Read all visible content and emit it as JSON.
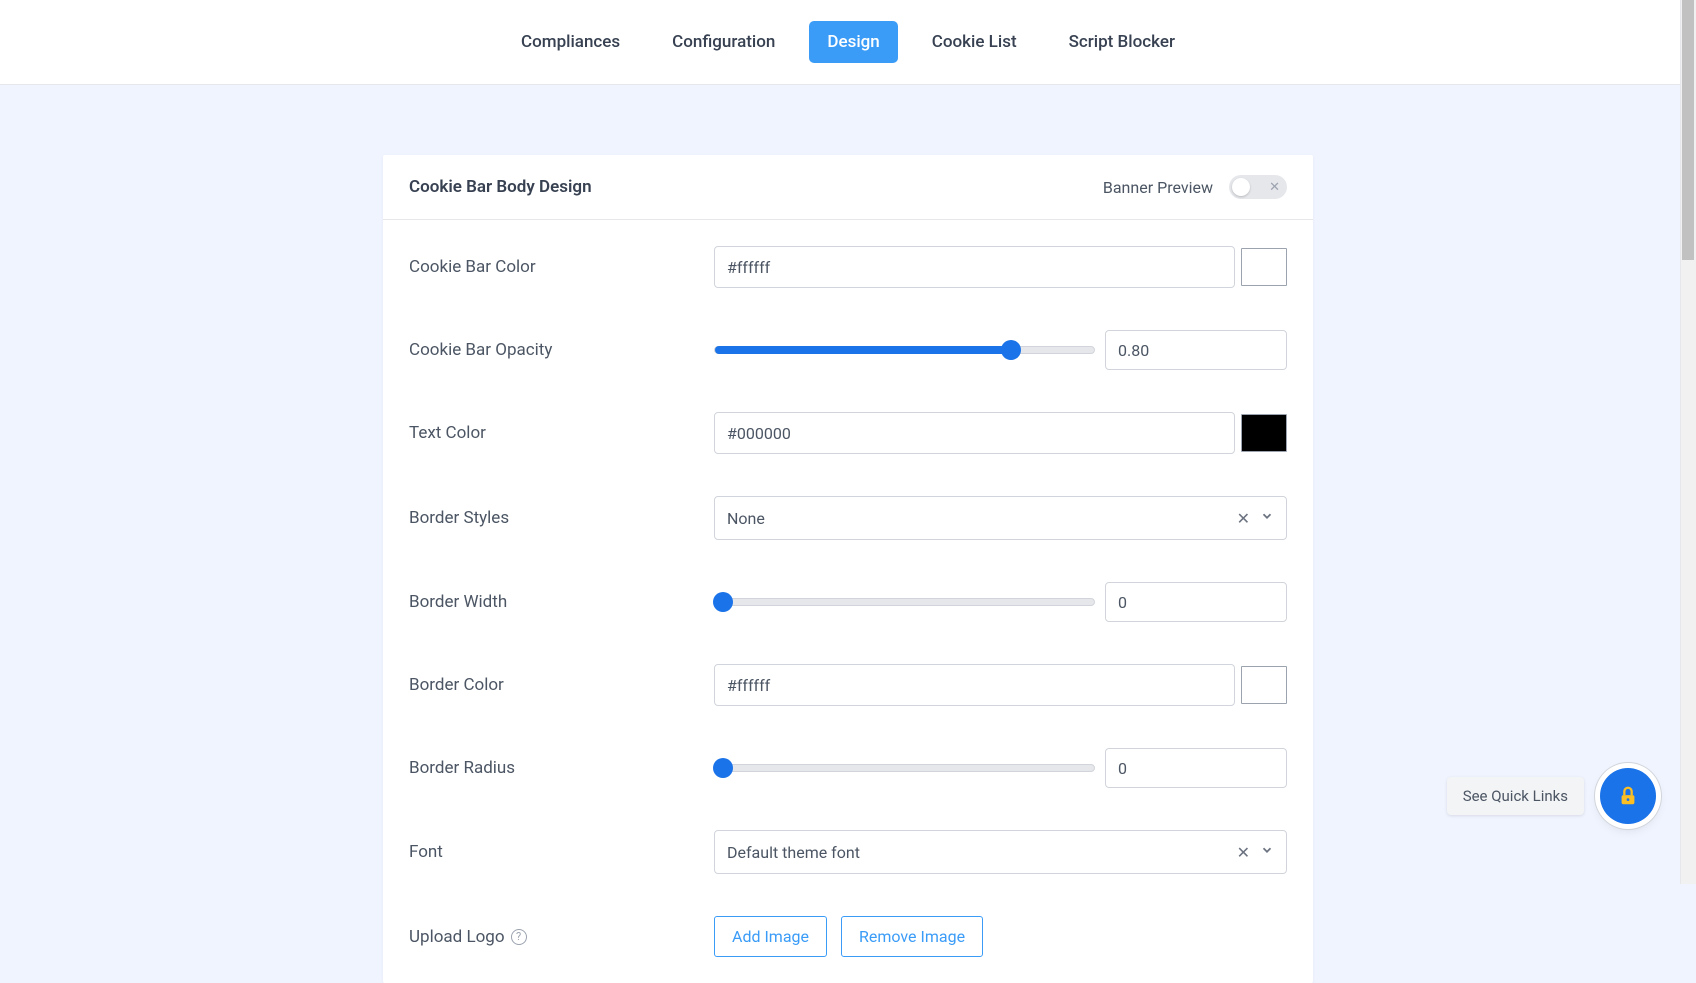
{
  "nav": {
    "tabs": [
      {
        "label": "Compliances",
        "active": false
      },
      {
        "label": "Configuration",
        "active": false
      },
      {
        "label": "Design",
        "active": true
      },
      {
        "label": "Cookie List",
        "active": false
      },
      {
        "label": "Script Blocker",
        "active": false
      }
    ]
  },
  "card": {
    "title": "Cookie Bar Body Design",
    "preview_label": "Banner Preview",
    "preview_enabled": false
  },
  "fields": {
    "cookie_bar_color": {
      "label": "Cookie Bar Color",
      "value": "#ffffff",
      "swatch": "#ffffff"
    },
    "cookie_bar_opacity": {
      "label": "Cookie Bar Opacity",
      "value": "0.80",
      "percent": 78
    },
    "text_color": {
      "label": "Text Color",
      "value": "#000000",
      "swatch": "#000000"
    },
    "border_styles": {
      "label": "Border Styles",
      "value": "None"
    },
    "border_width": {
      "label": "Border Width",
      "value": "0",
      "percent": 0
    },
    "border_color": {
      "label": "Border Color",
      "value": "#ffffff",
      "swatch": "#ffffff"
    },
    "border_radius": {
      "label": "Border Radius",
      "value": "0",
      "percent": 0
    },
    "font": {
      "label": "Font",
      "value": "Default theme font"
    },
    "upload_logo": {
      "label": "Upload Logo",
      "add_button": "Add Image",
      "remove_button": "Remove Image"
    }
  },
  "floating": {
    "quick_links": "See Quick Links"
  }
}
